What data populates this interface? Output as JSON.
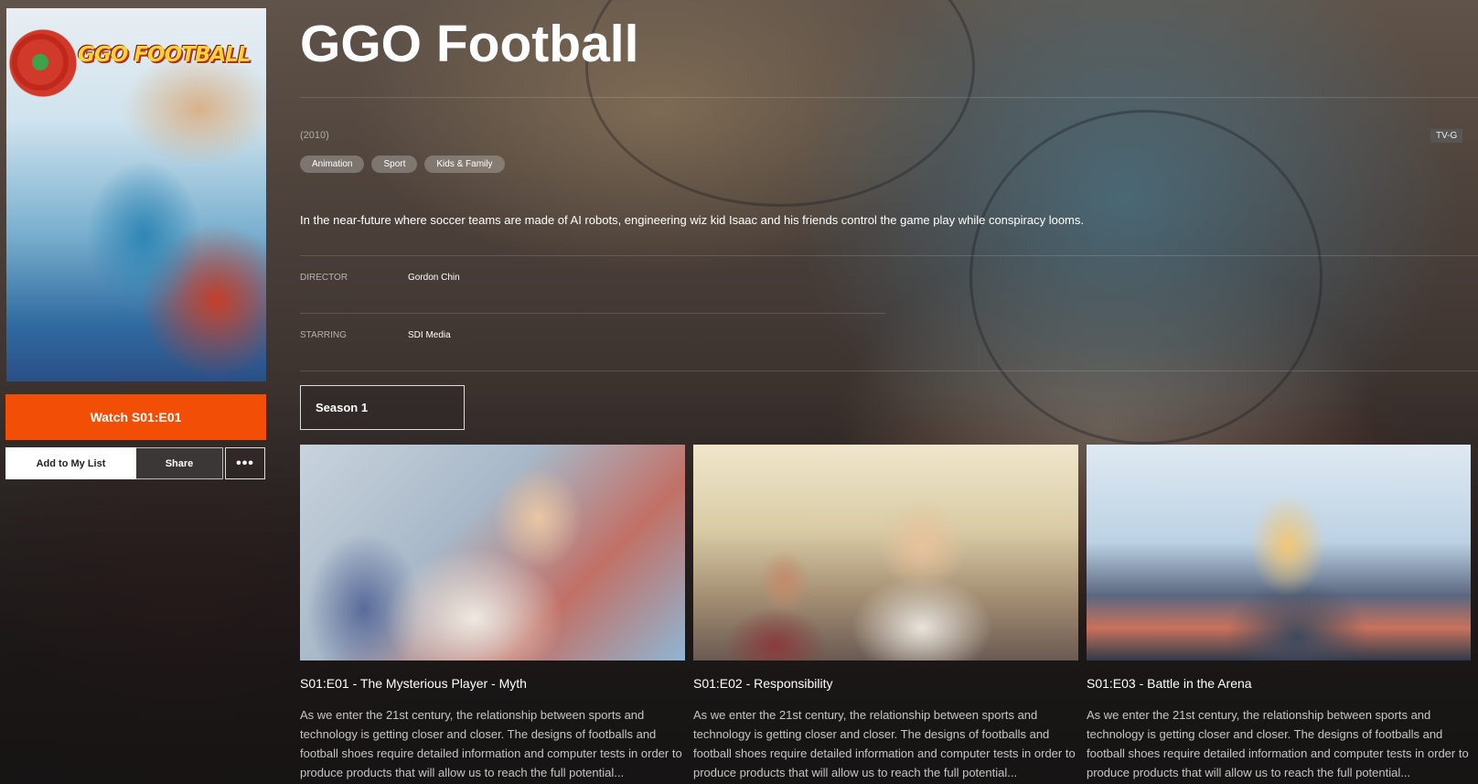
{
  "show": {
    "title": "GGO Football",
    "poster_logo_text": "GGO FOOTBALL",
    "year": "(2010)",
    "rating": "TV-G",
    "genres": [
      "Animation",
      "Sport",
      "Kids & Family"
    ],
    "synopsis": "In the near-future where soccer teams are made of AI robots, engineering wiz kid Isaac and his friends control the game play while conspiracy looms.",
    "director_label": "DIRECTOR",
    "director": "Gordon Chin",
    "starring_label": "STARRING",
    "starring": "SDI Media"
  },
  "actions": {
    "watch_label": "Watch S01:E01",
    "add_to_list_label": "Add to My List",
    "share_label": "Share",
    "more_label": "•••"
  },
  "season_selector": {
    "selected": "Season 1"
  },
  "episodes": [
    {
      "title": "S01:E01 - The Mysterious Player - Myth",
      "description": "As we enter the 21st century, the relationship between sports and technology is getting closer and closer. The designs of footballs and football shoes require detailed information and computer tests in order to produce products that will allow us to reach the full potential..."
    },
    {
      "title": "S01:E02 - Responsibility",
      "description": "As we enter the 21st century, the relationship between sports and technology is getting closer and closer. The designs of footballs and football shoes require detailed information and computer tests in order to produce products that will allow us to reach the full potential..."
    },
    {
      "title": "S01:E03 - Battle in the Arena",
      "description": "As we enter the 21st century, the relationship between sports and technology is getting closer and closer. The designs of footballs and football shoes require detailed information and computer tests in order to produce products that will allow us to reach the full potential..."
    }
  ],
  "colors": {
    "accent": "#f24e06",
    "text": "#ffffff"
  }
}
